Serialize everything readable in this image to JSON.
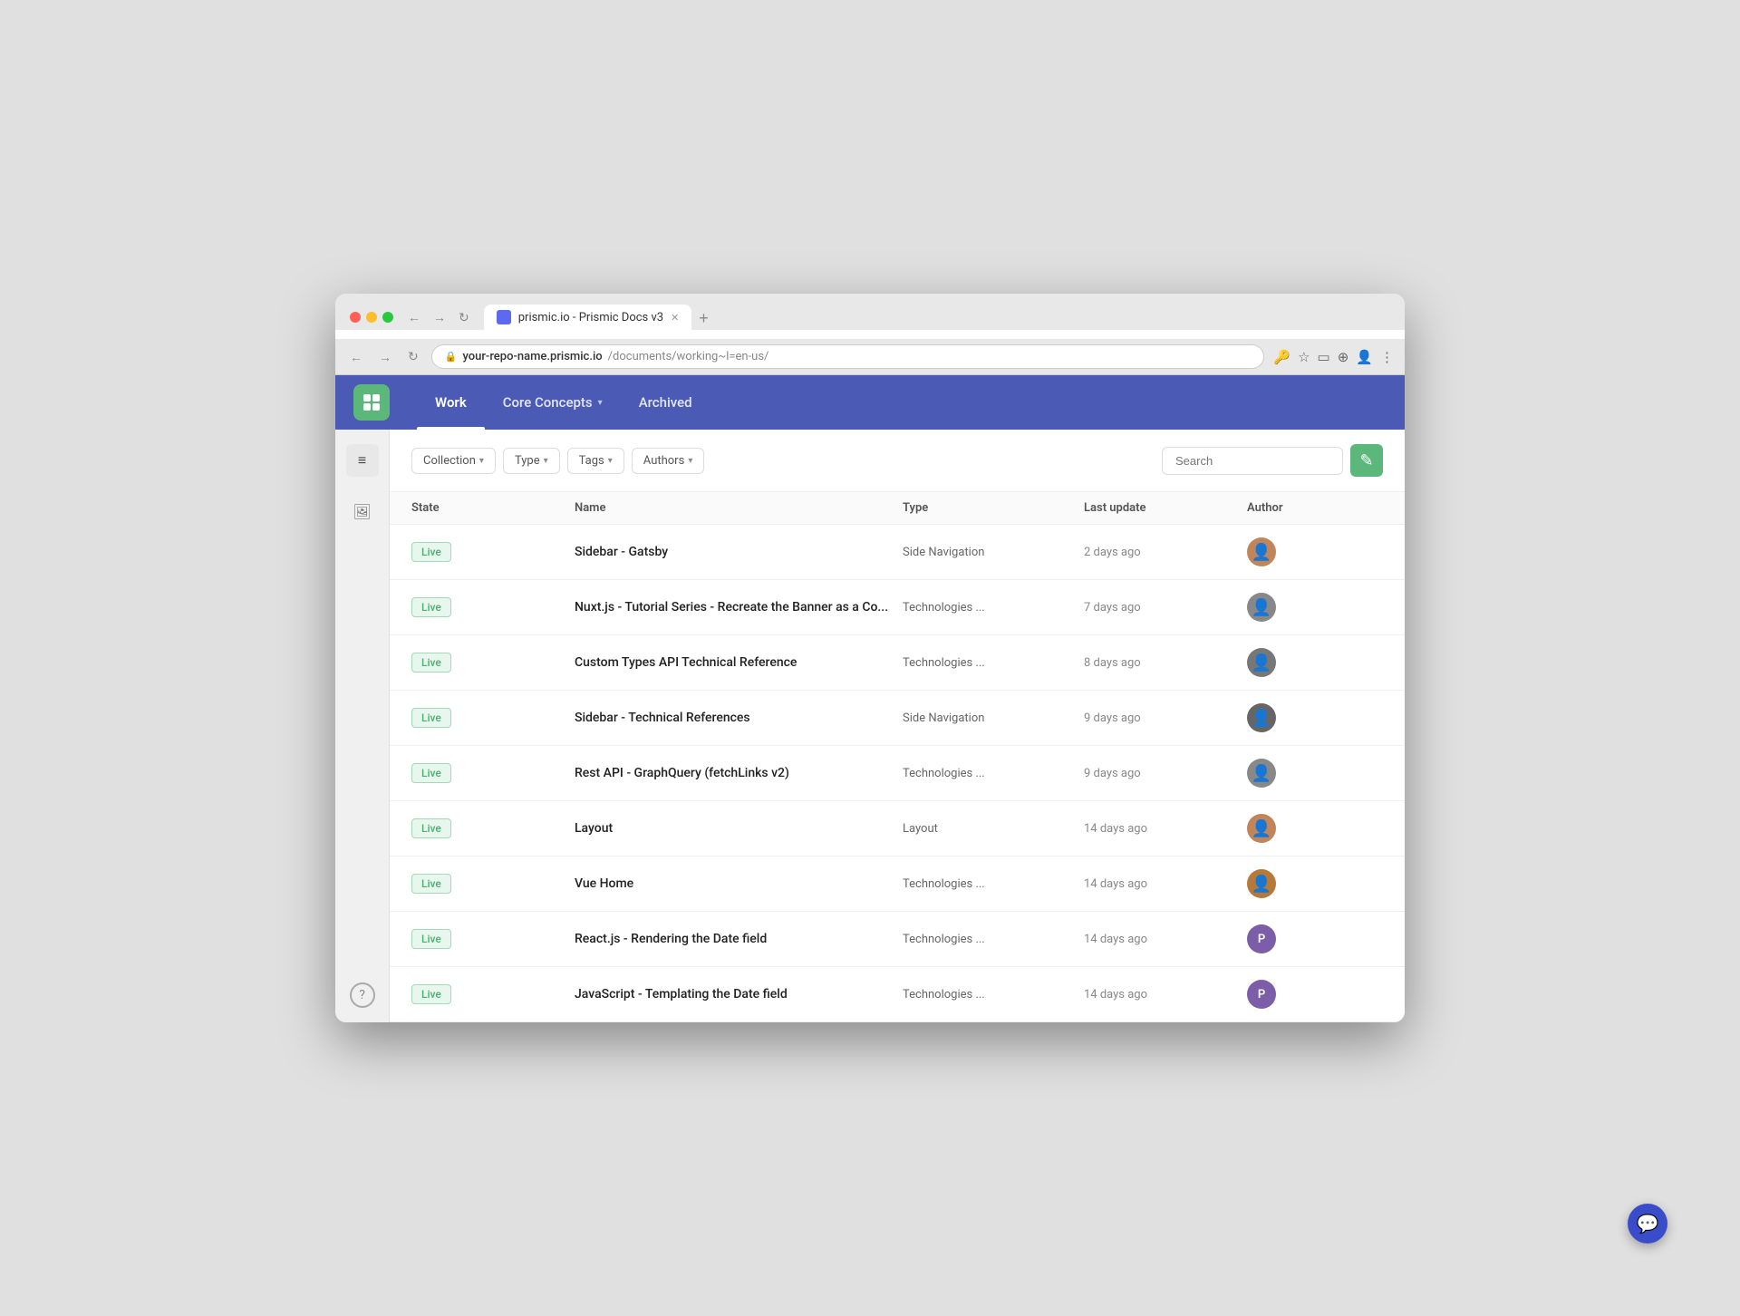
{
  "browser": {
    "tab_title": "prismic.io - Prismic Docs v3",
    "url_domain": "your-repo-name.prismic.io",
    "url_path": "/documents/working~l=en-us/"
  },
  "nav": {
    "items": [
      {
        "id": "work",
        "label": "Work",
        "active": true,
        "has_dropdown": false
      },
      {
        "id": "core-concepts",
        "label": "Core Concepts",
        "active": false,
        "has_dropdown": true
      },
      {
        "id": "archived",
        "label": "Archived",
        "active": false,
        "has_dropdown": false
      }
    ]
  },
  "filters": {
    "collection_label": "Collection",
    "type_label": "Type",
    "tags_label": "Tags",
    "authors_label": "Authors",
    "search_placeholder": "Search"
  },
  "table": {
    "columns": [
      "State",
      "Name",
      "Type",
      "Last update",
      "Author"
    ],
    "rows": [
      {
        "state": "Live",
        "name": "Sidebar - Gatsby",
        "type": "Side Navigation",
        "last_update": "2 days ago",
        "author_color": "#c0855a",
        "author_initial": ""
      },
      {
        "state": "Live",
        "name": "Nuxt.js - Tutorial Series - Recreate the Banner as a Co...",
        "type": "Technologies ...",
        "last_update": "7 days ago",
        "author_color": "#888",
        "author_initial": ""
      },
      {
        "state": "Live",
        "name": "Custom Types API Technical Reference",
        "type": "Technologies ...",
        "last_update": "8 days ago",
        "author_color": "#777",
        "author_initial": ""
      },
      {
        "state": "Live",
        "name": "Sidebar - Technical References",
        "type": "Side Navigation",
        "last_update": "9 days ago",
        "author_color": "#666",
        "author_initial": ""
      },
      {
        "state": "Live",
        "name": "Rest API - GraphQuery (fetchLinks v2)",
        "type": "Technologies ...",
        "last_update": "9 days ago",
        "author_color": "#888",
        "author_initial": ""
      },
      {
        "state": "Live",
        "name": "Layout",
        "type": "Layout",
        "last_update": "14 days ago",
        "author_color": "#c0855a",
        "author_initial": ""
      },
      {
        "state": "Live",
        "name": "Vue Home",
        "type": "Technologies ...",
        "last_update": "14 days ago",
        "author_color": "#b57a3a",
        "author_initial": ""
      },
      {
        "state": "Live",
        "name": "React.js - Rendering the Date field",
        "type": "Technologies ...",
        "last_update": "14 days ago",
        "author_color": "#7b5ea7",
        "author_initial": "P"
      },
      {
        "state": "Live",
        "name": "JavaScript - Templating the Date field",
        "type": "Technologies ...",
        "last_update": "14 days ago",
        "author_color": "#7b5ea7",
        "author_initial": "P"
      }
    ]
  },
  "sidebar": {
    "icons": [
      {
        "id": "docs",
        "symbol": "≡",
        "active": true
      },
      {
        "id": "media",
        "symbol": "🖼",
        "active": false
      }
    ],
    "help_label": "?"
  },
  "actions": {
    "new_doc_icon": "✎"
  }
}
